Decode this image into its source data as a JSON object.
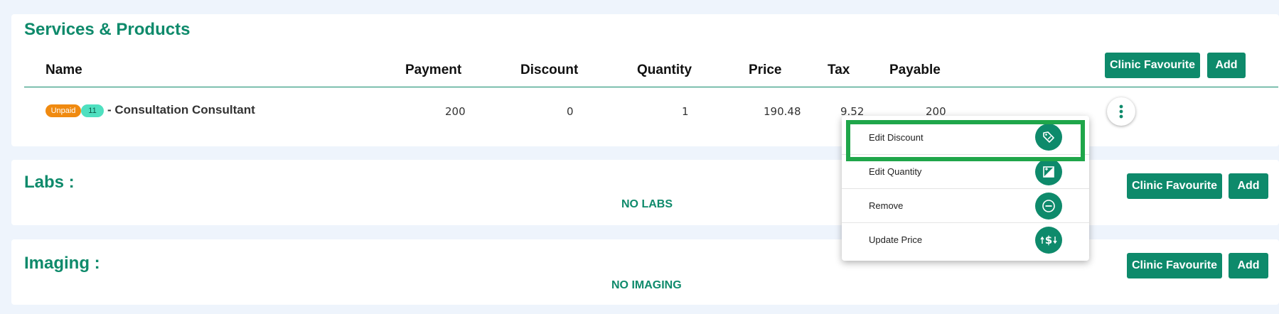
{
  "services": {
    "title": "Services & Products",
    "buttons": {
      "favourite": "Clinic Favourite",
      "add": "Add"
    },
    "columns": [
      "Name",
      "Payment",
      "Discount",
      "Quantity",
      "Price",
      "Tax",
      "Payable"
    ],
    "rows": [
      {
        "status_badge": "Unpaid",
        "count_badge": "11",
        "name": "- Consultation Consultant",
        "payment": "200",
        "discount": "0",
        "quantity": "1",
        "price": "190.48",
        "tax": "9.52",
        "payable": "200"
      }
    ],
    "row_menu_icon": "more-vertical-icon"
  },
  "row_menu": {
    "items": [
      {
        "label": "Edit Discount",
        "icon": "discount-tag-icon"
      },
      {
        "label": "Edit Quantity",
        "icon": "quantity-icon"
      },
      {
        "label": "Remove",
        "icon": "minus-circle-icon"
      },
      {
        "label": "Update Price",
        "icon": "price-update-icon"
      }
    ],
    "highlighted_item": "Edit Discount"
  },
  "labs": {
    "title": "Labs :",
    "empty": "NO LABS",
    "buttons": {
      "favourite": "Clinic Favourite",
      "add": "Add"
    }
  },
  "imaging": {
    "title": "Imaging :",
    "empty": "NO IMAGING",
    "buttons": {
      "favourite": "Clinic Favourite",
      "add": "Add"
    }
  },
  "colors": {
    "accent": "#0e8a6b",
    "unpaid_badge": "#f08a10",
    "count_badge": "#4fe0c0",
    "highlight": "#1fa64a",
    "page_background": "#eef4fc"
  }
}
